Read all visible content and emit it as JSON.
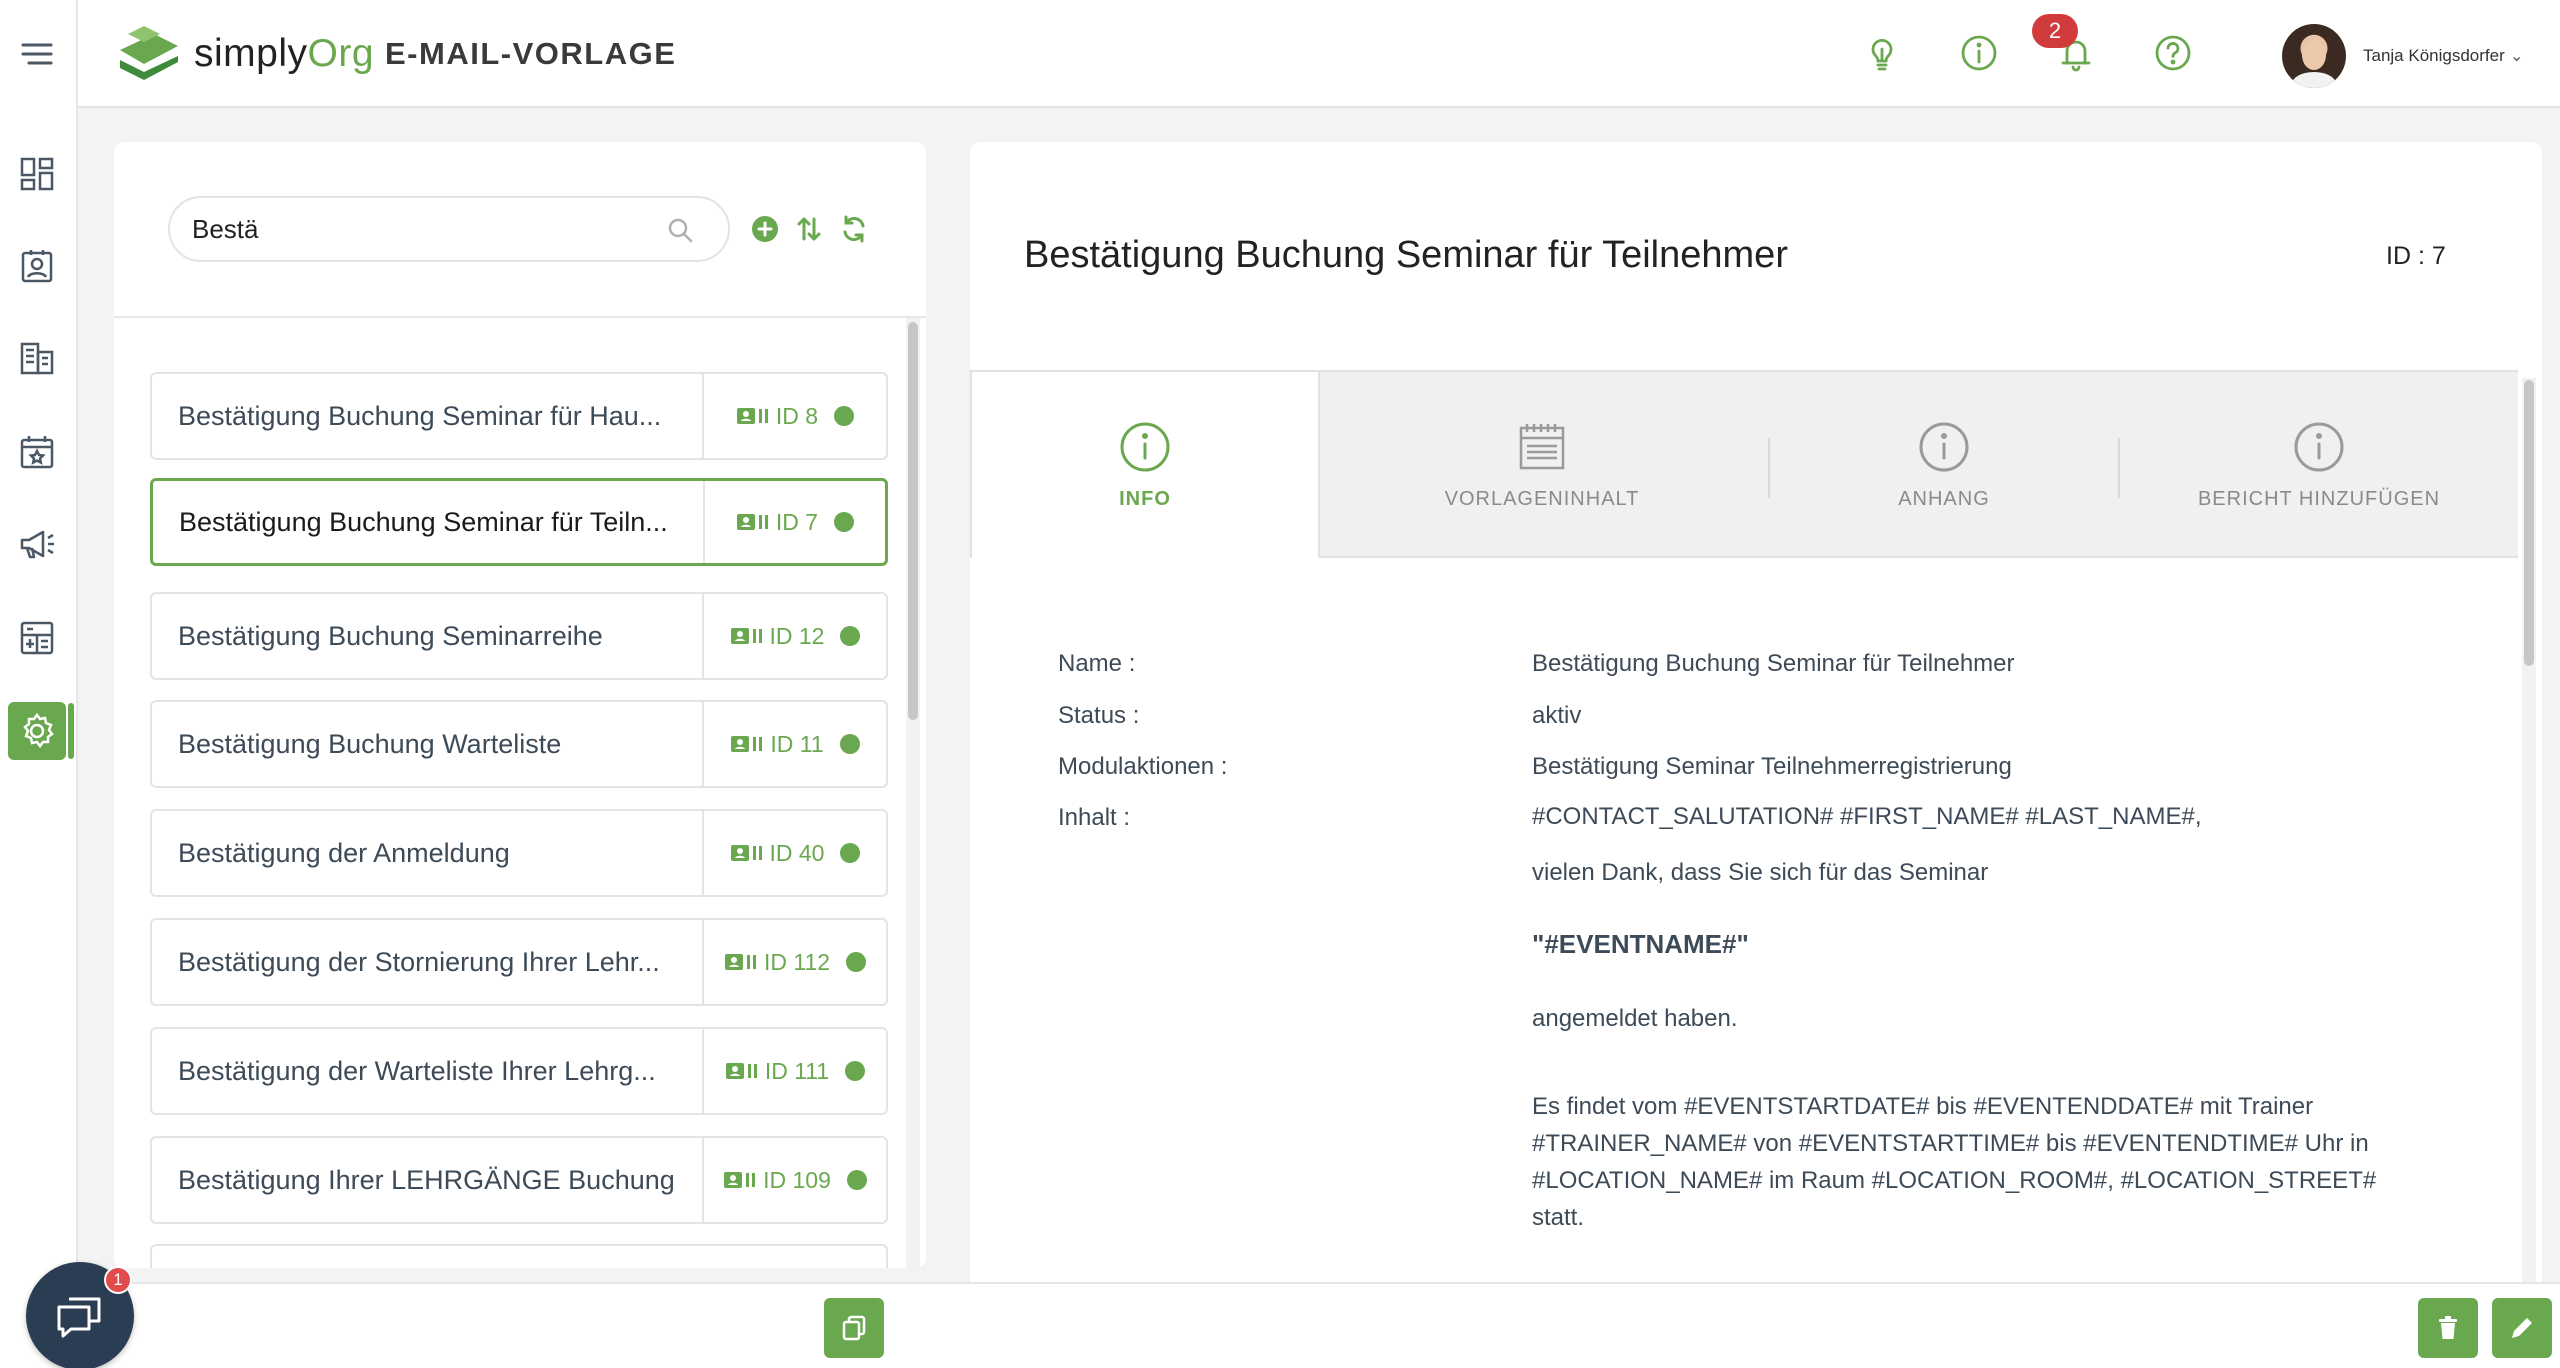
{
  "app": {
    "brand_simply": "simply",
    "brand_org": "Org",
    "page_title": "E-MAIL-VORLAGE"
  },
  "header": {
    "notification_count": "2",
    "user_name": "Tanja Königsdorfer",
    "icons": [
      "lightbulb-icon",
      "info-icon",
      "bell-icon",
      "help-icon"
    ]
  },
  "search": {
    "value": "Bestä",
    "placeholder": ""
  },
  "templates": [
    {
      "name": "Bestätigung Buchung Seminar für Haushalt",
      "display": "Bestätigung Buchung Seminar für Hau...",
      "id_label": "ID 8",
      "selected": false
    },
    {
      "name": "Bestätigung Buchung Seminar für Teilnehmer",
      "display": "Bestätigung Buchung Seminar für Teiln...",
      "id_label": "ID 7",
      "selected": true
    },
    {
      "name": "Bestätigung Buchung Seminarreihe",
      "display": "Bestätigung Buchung Seminarreihe",
      "id_label": "ID 12",
      "selected": false
    },
    {
      "name": "Bestätigung Buchung Warteliste",
      "display": "Bestätigung Buchung Warteliste",
      "id_label": "ID 11",
      "selected": false
    },
    {
      "name": "Bestätigung der Anmeldung",
      "display": "Bestätigung der Anmeldung",
      "id_label": "ID 40",
      "selected": false
    },
    {
      "name": "Bestätigung der Stornierung Ihrer Lehrgänge",
      "display": "Bestätigung der Stornierung Ihrer Lehr...",
      "id_label": "ID 112",
      "selected": false
    },
    {
      "name": "Bestätigung der Warteliste Ihrer Lehrgänge",
      "display": "Bestätigung der Warteliste Ihrer Lehrg...",
      "id_label": "ID 111",
      "selected": false
    },
    {
      "name": "Bestätigung Ihrer LEHRGÄNGE Buchung",
      "display": "Bestätigung Ihrer LEHRGÄNGE Buchung",
      "id_label": "ID 109",
      "selected": false
    }
  ],
  "detail": {
    "title": "Bestätigung Buchung Seminar für Teilnehmer",
    "id_label": "ID : 7",
    "tabs": [
      {
        "label": "INFO",
        "icon": "info-icon",
        "active": true
      },
      {
        "label": "VORLAGENINHALT",
        "icon": "notepad-icon",
        "active": false
      },
      {
        "label": "ANHANG",
        "icon": "info-icon",
        "active": false
      },
      {
        "label": "BERICHT HINZUFÜGEN",
        "icon": "info-icon",
        "active": false
      }
    ],
    "fields": {
      "name_label": "Name :",
      "name_value": "Bestätigung Buchung Seminar für Teilnehmer",
      "status_label": "Status :",
      "status_value": "aktiv",
      "modul_label": "Modulaktionen :",
      "modul_value": "Bestätigung Seminar Teilnehmerregistrierung",
      "inhalt_label": "Inhalt :"
    },
    "content": {
      "line1": "#CONTACT_SALUTATION# #FIRST_NAME# #LAST_NAME#,",
      "line2": "vielen Dank, dass Sie sich für das Seminar",
      "line3": "\"#EVENTNAME#\"",
      "line4": "angemeldet haben.",
      "line5": "Es findet vom #EVENTSTARTDATE# bis #EVENTENDDATE# mit Trainer #TRAINER_NAME# von #EVENTSTARTTIME# bis #EVENTENDTIME# Uhr in #LOCATION_NAME# im Raum #LOCATION_ROOM#, #LOCATION_STREET# statt."
    }
  },
  "chat": {
    "badge": "1"
  },
  "colors": {
    "accent": "#6aa84f",
    "badge": "#d23b3b",
    "chat": "#2b3d52"
  }
}
